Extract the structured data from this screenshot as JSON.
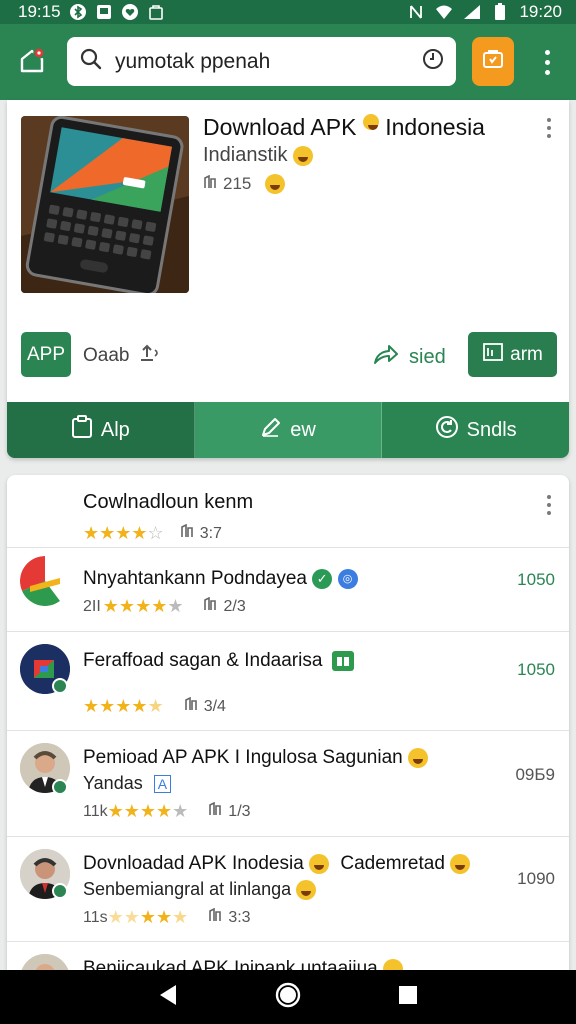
{
  "status_bar": {
    "time_left": "19:15",
    "time_right": "19:20"
  },
  "app_bar": {
    "search_query": "yumotak ppenah",
    "icons": [
      "home-alert-icon",
      "search-icon",
      "clock-icon",
      "shopping-tag-icon",
      "overflow-menu-icon"
    ]
  },
  "featured": {
    "title": "Download APK",
    "title_suffix": "Indonesia",
    "subtitle": "Indianstik",
    "meta_count": "215",
    "app_badge": "APP",
    "left_label": "Oaab",
    "share_label": "sied",
    "farm_label": "arm",
    "tabs": [
      {
        "label": "Alp",
        "icon": "clipboard-icon"
      },
      {
        "label": "ew",
        "icon": "pen-icon"
      },
      {
        "label": "Sndls",
        "icon": "refresh-icon"
      }
    ]
  },
  "list": {
    "header": "Cowlnadloun kenm",
    "header_rating": "3:7",
    "header_stars": 4,
    "items": [
      {
        "title": "Nnyahtankann Podndayea",
        "subtitle": "",
        "rating_prefix": "2II",
        "stars": 4,
        "count": "2/3",
        "value": "1050",
        "value_color": "#2a8553"
      },
      {
        "title": "Feraffoad sagan & Indaarisa",
        "subtitle": "",
        "rating_prefix": "",
        "stars": 4.5,
        "count": "3/4",
        "value": "1050",
        "value_color": "#2a8553"
      },
      {
        "title": "Pemioad AP APK I Ingulosa Sagunian",
        "subtitle": "Yandas",
        "subtitle_badge": "A",
        "rating_prefix": "11k",
        "stars": 4,
        "count": "1/3",
        "value": "09Б9",
        "value_color": "#555555"
      },
      {
        "title": "Dovnloadad APK Inodesia",
        "title_suffix": "Cademretad",
        "subtitle": "Senbemiangral at linlanga",
        "rating_prefix": "11s",
        "stars": 3.5,
        "count": "3:3",
        "value": "1090",
        "value_color": "#555555"
      },
      {
        "title": "Benijcaukad APK Inipank untaaiiua",
        "subtitle": "",
        "rating_prefix": "",
        "stars": 0,
        "count": "",
        "value": "",
        "value_color": "#555555"
      }
    ]
  },
  "nav_bar": {
    "buttons": [
      "back-icon",
      "home-icon",
      "recents-icon"
    ]
  }
}
